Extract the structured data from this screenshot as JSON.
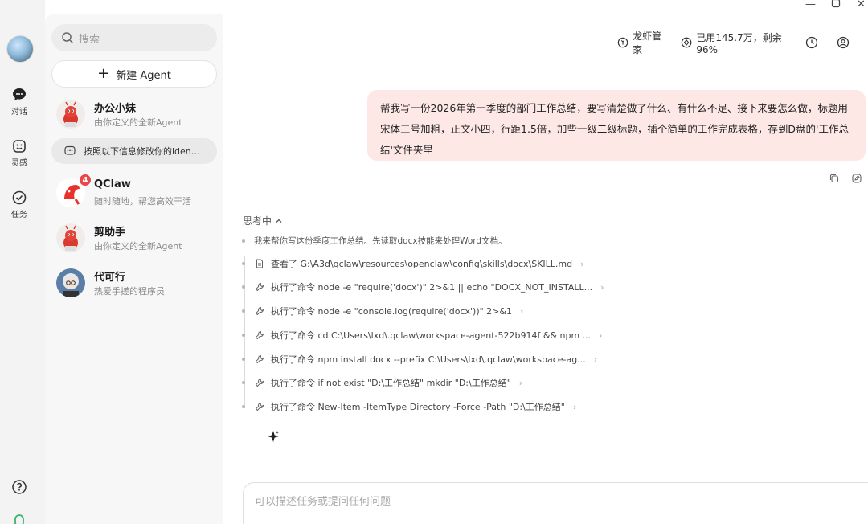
{
  "rail": {
    "items": [
      {
        "label": "对话",
        "icon": "chat-icon"
      },
      {
        "label": "灵感",
        "icon": "inspiration-icon"
      },
      {
        "label": "任务",
        "icon": "task-icon"
      }
    ]
  },
  "search": {
    "placeholder": "搜索"
  },
  "new_agent": {
    "label": "新建 Agent"
  },
  "agents": [
    {
      "name": "办公小妹",
      "desc": "由你定义的全新Agent"
    },
    {
      "name": "QClaw",
      "desc": "随时随地，帮您高效干活",
      "badge": "4"
    },
    {
      "name": "剪助手",
      "desc": "由你定义的全新Agent"
    },
    {
      "name": "代可行",
      "desc": "热爱手搓的程序员"
    }
  ],
  "sub_item": {
    "label": "按照以下信息修改你的iden…"
  },
  "header": {
    "butler": "龙虾管家",
    "usage": "已用145.7万，剩余96%"
  },
  "user_message": "帮我写一份2026年第一季度的部门工作总结，要写清楚做了什么、有什么不足、接下来要怎么做，标题用宋体三号加粗，正文小四，行距1.5倍，加些一级二级标题，插个简单的工作完成表格，存到D盘的'工作总结'文件夹里",
  "thinking": {
    "label": "思考中"
  },
  "steps": {
    "intro": "我来帮你写这份季度工作总结。先读取docx技能来处理Word文档。",
    "items": [
      {
        "text": "查看了 G:\\A3d\\qclaw\\resources\\openclaw\\config\\skills\\docx\\SKILL.md",
        "icon": "file-icon"
      },
      {
        "text": "执行了命令 node -e \"require('docx')\" 2>&1 || echo \"DOCX_NOT_INSTALL...",
        "icon": "wrench-icon"
      },
      {
        "text": "执行了命令 node -e \"console.log(require('docx'))\" 2>&1",
        "icon": "wrench-icon"
      },
      {
        "text": "执行了命令 cd C:\\Users\\lxd\\.qclaw\\workspace-agent-522b914f && npm ...",
        "icon": "wrench-icon"
      },
      {
        "text": "执行了命令 npm install docx --prefix C:\\Users\\lxd\\.qclaw\\workspace-ag...",
        "icon": "wrench-icon"
      },
      {
        "text": "执行了命令 if not exist \"D:\\工作总结\" mkdir \"D:\\工作总结\"",
        "icon": "wrench-icon"
      },
      {
        "text": "执行了命令 New-Item -ItemType Directory -Force -Path \"D:\\工作总结\"",
        "icon": "wrench-icon"
      }
    ]
  },
  "composer": {
    "placeholder": "可以描述任务或提问任何问题"
  },
  "colors": {
    "user_bubble": "#fde8e6",
    "badge": "#e94848",
    "accent_green": "#3bb36a"
  }
}
